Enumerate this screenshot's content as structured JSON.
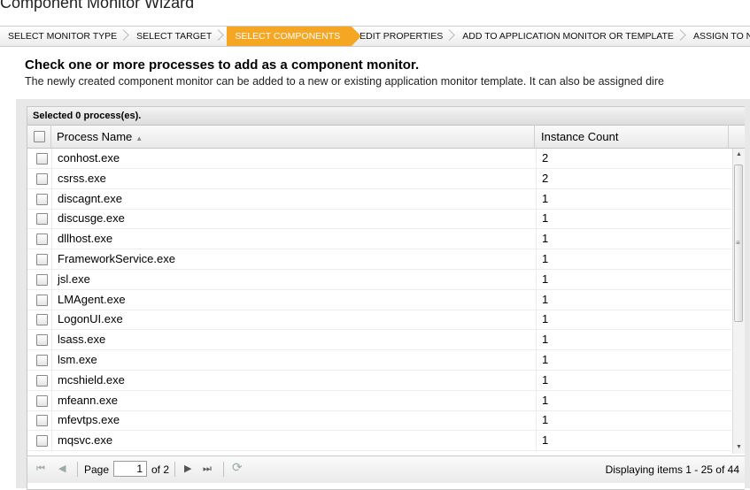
{
  "wizard": {
    "title": "Component Monitor Wizard",
    "steps": [
      {
        "label": "SELECT MONITOR TYPE",
        "active": false
      },
      {
        "label": "SELECT TARGET",
        "active": false
      },
      {
        "label": "SELECT COMPONENTS",
        "active": true
      },
      {
        "label": "EDIT PROPERTIES",
        "active": false
      },
      {
        "label": "ADD TO APPLICATION MONITOR OR TEMPLATE",
        "active": false
      },
      {
        "label": "ASSIGN TO NODES",
        "active": false
      }
    ]
  },
  "intro": {
    "heading": "Check one or more processes to add as a component monitor.",
    "description": "The newly created component monitor can be added to a new or existing application monitor template. It can also be assigned dire"
  },
  "grid": {
    "selection_status": "Selected 0 process(es).",
    "columns": {
      "name": "Process Name",
      "count": "Instance Count"
    },
    "sort_indicator": "▲",
    "rows": [
      {
        "name": "conhost.exe",
        "count": "2"
      },
      {
        "name": "csrss.exe",
        "count": "2"
      },
      {
        "name": "discagnt.exe",
        "count": "1"
      },
      {
        "name": "discusge.exe",
        "count": "1"
      },
      {
        "name": "dllhost.exe",
        "count": "1"
      },
      {
        "name": "FrameworkService.exe",
        "count": "1"
      },
      {
        "name": "jsl.exe",
        "count": "1"
      },
      {
        "name": "LMAgent.exe",
        "count": "1"
      },
      {
        "name": "LogonUI.exe",
        "count": "1"
      },
      {
        "name": "lsass.exe",
        "count": "1"
      },
      {
        "name": "lsm.exe",
        "count": "1"
      },
      {
        "name": "mcshield.exe",
        "count": "1"
      },
      {
        "name": "mfeann.exe",
        "count": "1"
      },
      {
        "name": "mfevtps.exe",
        "count": "1"
      },
      {
        "name": "mqsvc.exe",
        "count": "1"
      }
    ]
  },
  "pager": {
    "page_label": "Page",
    "page_value": "1",
    "of_label": "of 2",
    "info": "Displaying items 1 - 25 of 44"
  },
  "icons": {
    "first": "⏮",
    "prev": "◀",
    "next": "▶",
    "last": "⏭",
    "refresh": "⟳"
  },
  "colors": {
    "active_step": "#f5a623"
  }
}
